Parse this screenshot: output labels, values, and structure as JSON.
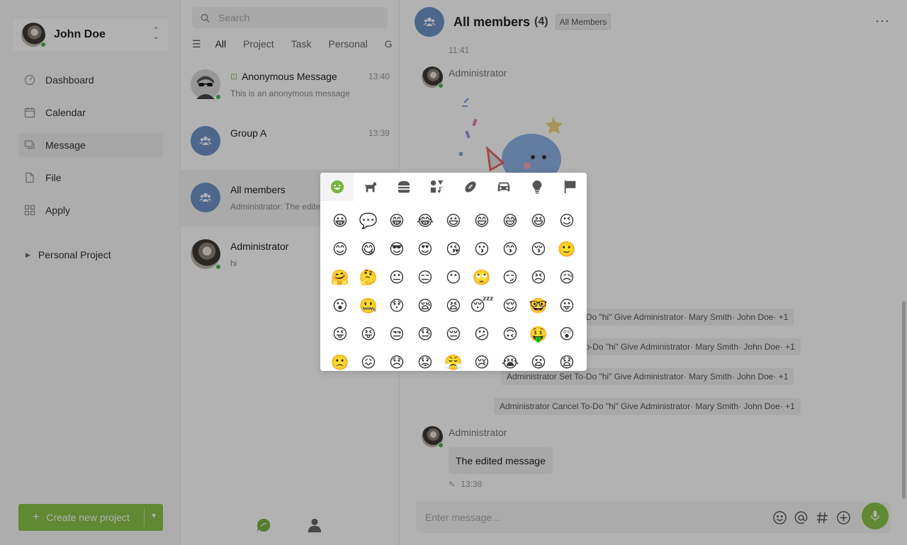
{
  "user": {
    "name": "John Doe"
  },
  "nav": [
    {
      "label": "Dashboard",
      "icon": "dashboard-icon"
    },
    {
      "label": "Calendar",
      "icon": "calendar-icon"
    },
    {
      "label": "Message",
      "icon": "message-icon"
    },
    {
      "label": "File",
      "icon": "file-icon"
    },
    {
      "label": "Apply",
      "icon": "apply-icon"
    }
  ],
  "project_tree": {
    "label": "Personal Project"
  },
  "create_button": {
    "label": "Create new project"
  },
  "search": {
    "placeholder": "Search"
  },
  "filters": {
    "tabs": [
      "All",
      "Project",
      "Task",
      "Personal",
      "G"
    ]
  },
  "conversations": [
    {
      "name": "Anonymous Message",
      "time": "13:40",
      "preview": "This is an anonymous message"
    },
    {
      "name": "Group A",
      "time": "13:39",
      "preview": ""
    },
    {
      "name": "All members",
      "time": "",
      "preview": "Administrator: The edited message"
    },
    {
      "name": "Administrator",
      "time": "",
      "preview": "hi"
    }
  ],
  "chat": {
    "title": "All members",
    "count": "(4)",
    "badge": "All Members",
    "top_time": "11:41",
    "sender1": "Administrator",
    "sender2": "Administrator",
    "system_messages": [
      "Administrator Set To-Do \"hi\" Give Administrator· Mary Smith· John Doe· +1",
      "Administrator Cancel To-Do \"hi\" Give Administrator· Mary Smith· John Doe· +1",
      "Administrator Set To-Do \"hi\" Give Administrator· Mary Smith· John Doe· +1",
      "Administrator Cancel To-Do \"hi\" Give Administrator· Mary Smith· John Doe· +1"
    ],
    "bubble": "The edited message",
    "edited_time": "13:38",
    "composer_placeholder": "Enter message..."
  },
  "emoji_picker": {
    "categories": [
      "smileys-icon",
      "animals-icon",
      "food-icon",
      "activities-icon",
      "sports-icon",
      "travel-icon",
      "objects-icon",
      "flags-icon"
    ],
    "active_category": 0,
    "emojis": [
      "😀",
      "💬",
      "😁",
      "😂",
      "😃",
      "😄",
      "😅",
      "😆",
      "😉",
      "😊",
      "😋",
      "😎",
      "😍",
      "😘",
      "😗",
      "😙",
      "😚",
      "🙂",
      "🤗",
      "🤔",
      "😐",
      "😑",
      "😶",
      "🙄",
      "😏",
      "😣",
      "😥",
      "😮",
      "🤐",
      "😯",
      "😪",
      "😫",
      "😴",
      "😌",
      "🤓",
      "😛",
      "😜",
      "😝",
      "😒",
      "😓",
      "😔",
      "😕",
      "🙃",
      "🤑",
      "😲",
      "🙁",
      "😖",
      "😞",
      "😟",
      "😤",
      "😢",
      "😭",
      "😦",
      "😧"
    ]
  },
  "colors": {
    "accent": "#8bc34a",
    "group_avatar": "#6d93c9",
    "online": "#4caf50"
  }
}
